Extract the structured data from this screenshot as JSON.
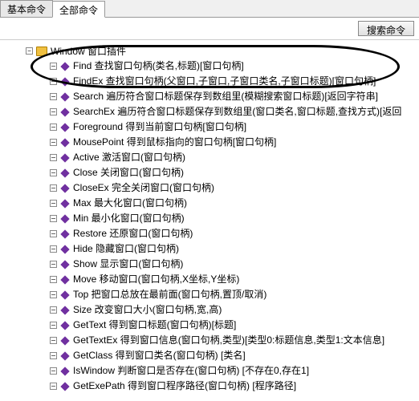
{
  "tabs": {
    "basic": "基本命令",
    "all": "全部命令"
  },
  "toolbar": {
    "search": "搜索命令"
  },
  "tree": {
    "root": "Window 窗口插件",
    "items": [
      "Find 查找窗口句柄(类名,标题)[窗口句柄]",
      "FindEx 查找窗口句柄(父窗口,子窗口,子窗口类名,子窗口标题)[窗口句柄]",
      "Search 遍历符合窗口标题保存到数组里(模糊搜索窗口标题)[返回字符串]",
      "SearchEx 遍历符合窗口标题保存到数组里(窗口类名,窗口标题,查找方式)[返回",
      "Foreground 得到当前窗口句柄[窗口句柄]",
      "MousePoint 得到鼠标指向的窗口句柄[窗口句柄]",
      "Active 激活窗口(窗口句柄)",
      "Close 关闭窗口(窗口句柄)",
      "CloseEx 完全关闭窗口(窗口句柄)",
      "Max 最大化窗口(窗口句柄)",
      "Min 最小化窗口(窗口句柄)",
      "Restore 还原窗口(窗口句柄)",
      "Hide 隐藏窗口(窗口句柄)",
      "Show 显示窗口(窗口句柄)",
      "Move 移动窗口(窗口句柄,X坐标,Y坐标)",
      "Top 把窗口总放在最前面(窗口句柄,置顶/取消)",
      "Size 改变窗口大小(窗口句柄,宽,高)",
      "GetText 得到窗口标题(窗口句柄)[标题]",
      "GetTextEx 得到窗口信息(窗口句柄,类型)[类型0:标题信息,类型1:文本信息]",
      "GetClass 得到窗口类名(窗口句柄) [类名]",
      "IsWindow 判断窗口是否存在(窗口句柄) [不存在0,存在1]",
      "GetExePath 得到窗口程序路径(窗口句柄) [程序路径]"
    ]
  }
}
